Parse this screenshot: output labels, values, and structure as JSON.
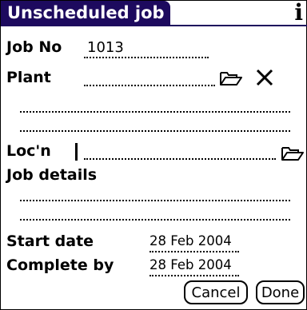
{
  "window": {
    "title": "Unscheduled job"
  },
  "icons": {
    "info": "i",
    "info_name": "info-icon",
    "folder_name": "folder-icon",
    "clear_name": "close-icon"
  },
  "form": {
    "job_no_label": "Job No",
    "job_no_value": "1013",
    "plant_label": "Plant",
    "plant_value": "",
    "location_label": "Loc'n",
    "location_value": "",
    "job_details_label": "Job details",
    "start_date_label": "Start date",
    "start_date_value": "28 Feb 2004",
    "complete_by_label": "Complete by",
    "complete_by_value": "28 Feb 2004"
  },
  "buttons": {
    "cancel": "Cancel",
    "done": "Done"
  }
}
